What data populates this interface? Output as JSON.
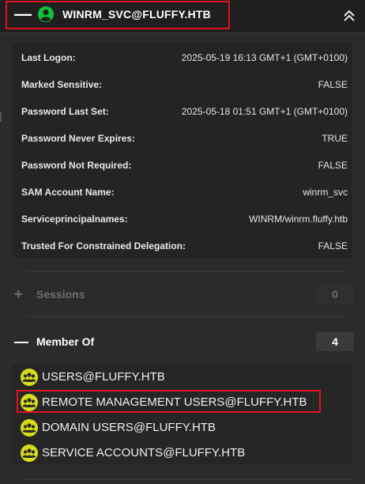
{
  "header": {
    "collapse_symbol": "—",
    "title": "WINRM_SVC@FLUFFY.HTB",
    "user_icon": "user-circle-icon",
    "chevron_icon": "double-chevron-up-icon",
    "user_icon_color": "#12c23a"
  },
  "properties": [
    {
      "key": "Last Logon:",
      "value": "2025-05-19 16:13 GMT+1 (GMT+0100)"
    },
    {
      "key": "Marked Sensitive:",
      "value": "FALSE"
    },
    {
      "key": "Password Last Set:",
      "value": "2025-05-18 01:51 GMT+1 (GMT+0100)"
    },
    {
      "key": "Password Never Expires:",
      "value": "TRUE"
    },
    {
      "key": "Password Not Required:",
      "value": "FALSE"
    },
    {
      "key": "SAM Account Name:",
      "value": "winrm_svc"
    },
    {
      "key": "Serviceprincipalnames:",
      "value": "WINRM/winrm.fluffy.htb"
    },
    {
      "key": "Trusted For Constrained Delegation:",
      "value": "FALSE"
    }
  ],
  "sessions": {
    "sign": "+",
    "label": "Sessions",
    "count": "0"
  },
  "member_of": {
    "sign": "—",
    "label": "Member Of",
    "count": "4",
    "icon_color": "#d9dc1a",
    "groups": [
      {
        "name": "USERS@FLUFFY.HTB"
      },
      {
        "name": "REMOTE MANAGEMENT USERS@FLUFFY.HTB"
      },
      {
        "name": "DOMAIN USERS@FLUFFY.HTB"
      },
      {
        "name": "SERVICE ACCOUNTS@FLUFFY.HTB"
      }
    ]
  }
}
